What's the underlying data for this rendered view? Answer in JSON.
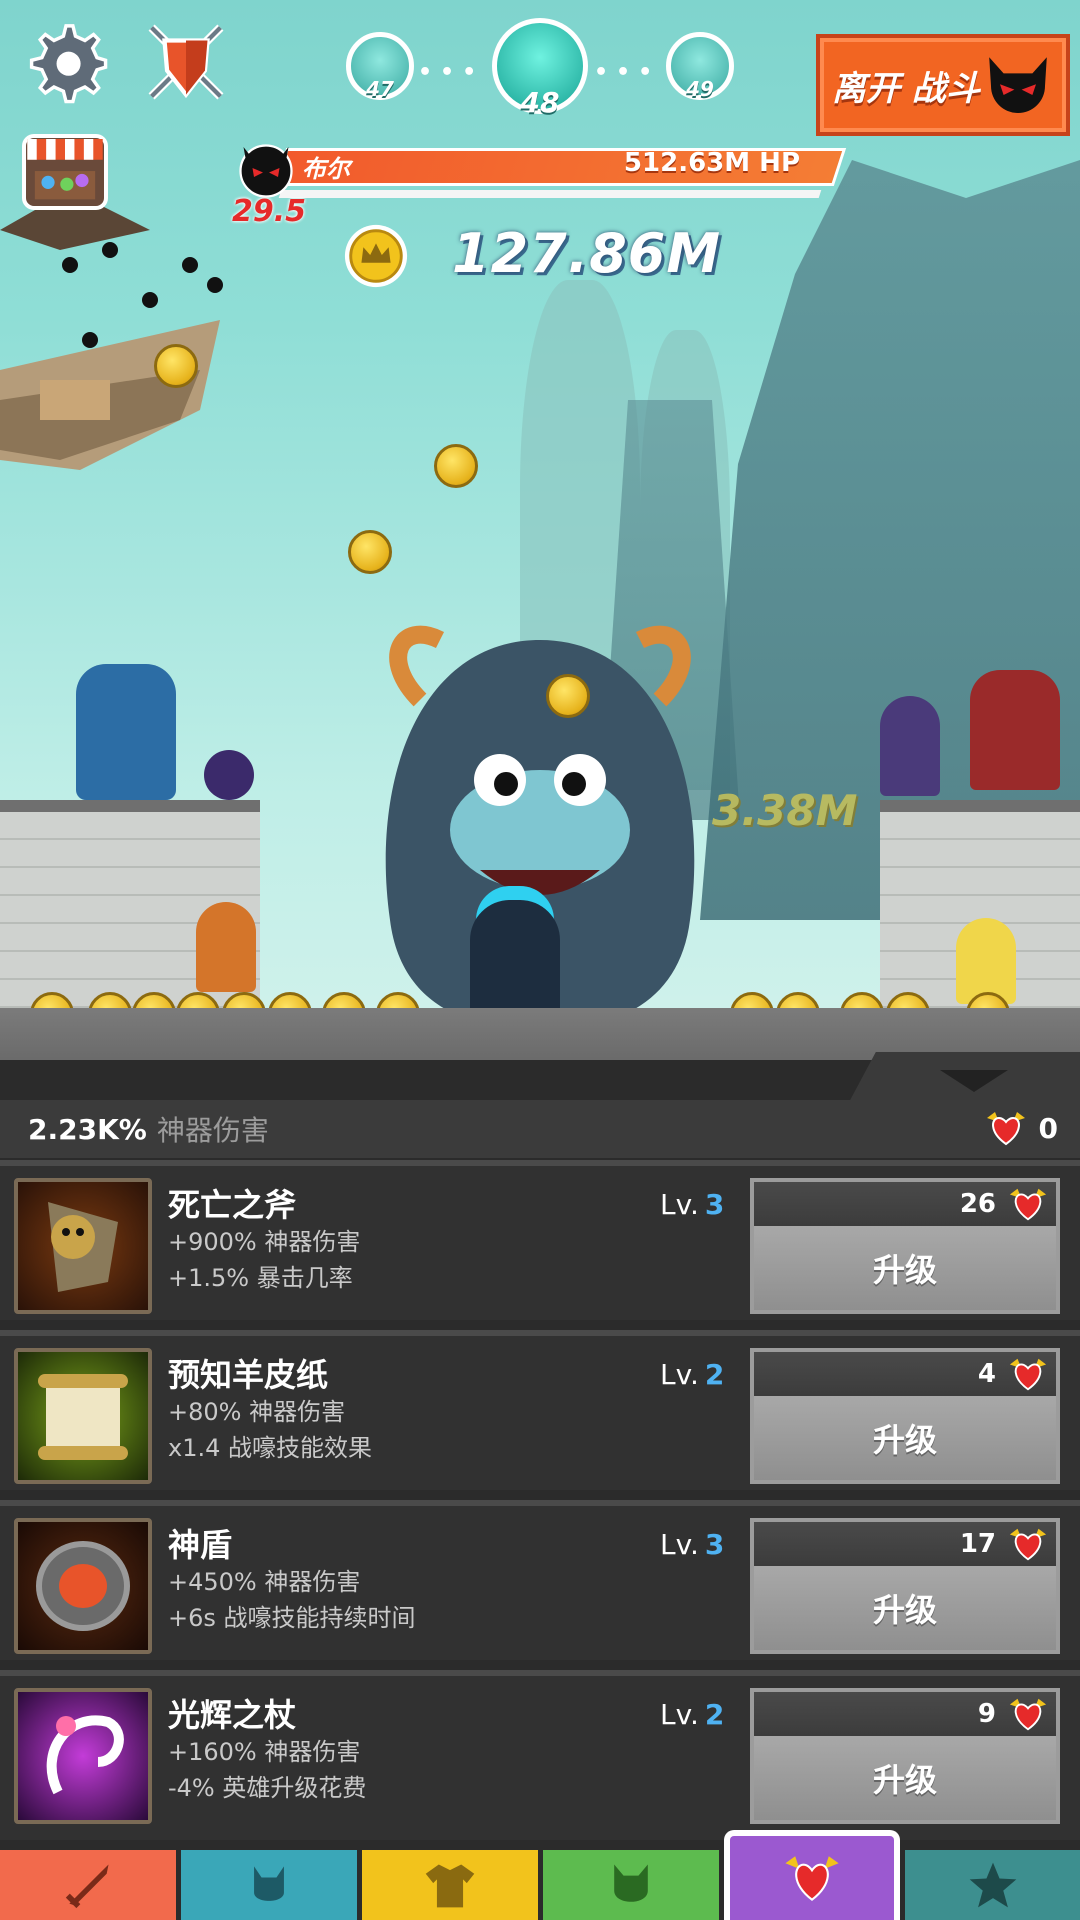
{
  "hud": {
    "stages": {
      "prev": "47",
      "current": "48",
      "next": "49"
    },
    "leave_button": "离开 战斗",
    "boss_name": "布尔",
    "boss_hp": "512.63M HP",
    "boss_timer": "29.5",
    "gold": "127.86M",
    "damage_popup": "3.38M"
  },
  "panel": {
    "artifact_damage": "2.23K%",
    "artifact_damage_label": "神器伤害",
    "relics": "0"
  },
  "artifacts": [
    {
      "name": "死亡之斧",
      "effect1": "+900% 神器伤害",
      "effect2": "+1.5% 暴击几率",
      "level_label": "Lv.",
      "level": "3",
      "cost": "26",
      "button": "升级"
    },
    {
      "name": "预知羊皮纸",
      "effect1": "+80% 神器伤害",
      "effect2": "x1.4 战嚎技能效果",
      "level_label": "Lv.",
      "level": "2",
      "cost": "4",
      "button": "升级"
    },
    {
      "name": "神盾",
      "effect1": "+450% 神器伤害",
      "effect2": "+6s 战嚎技能持续时间",
      "level_label": "Lv.",
      "level": "3",
      "cost": "17",
      "button": "升级"
    },
    {
      "name": "光辉之杖",
      "effect1": "+160% 神器伤害",
      "effect2": "-4% 英雄升级花费",
      "level_label": "Lv.",
      "level": "2",
      "cost": "9",
      "button": "升级"
    }
  ],
  "nav": {
    "tabs": [
      {
        "icon": "sword-icon",
        "color": "#f26a4c"
      },
      {
        "icon": "helmet-icon",
        "color": "#3aa7b8"
      },
      {
        "icon": "shirt-icon",
        "color": "#f2c31c"
      },
      {
        "icon": "pet-icon",
        "color": "#5dbb4f"
      },
      {
        "icon": "heart-wings-icon",
        "color": "#9b59d0",
        "active": true
      },
      {
        "icon": "star-icon",
        "color": "#3d8f8f"
      }
    ]
  }
}
